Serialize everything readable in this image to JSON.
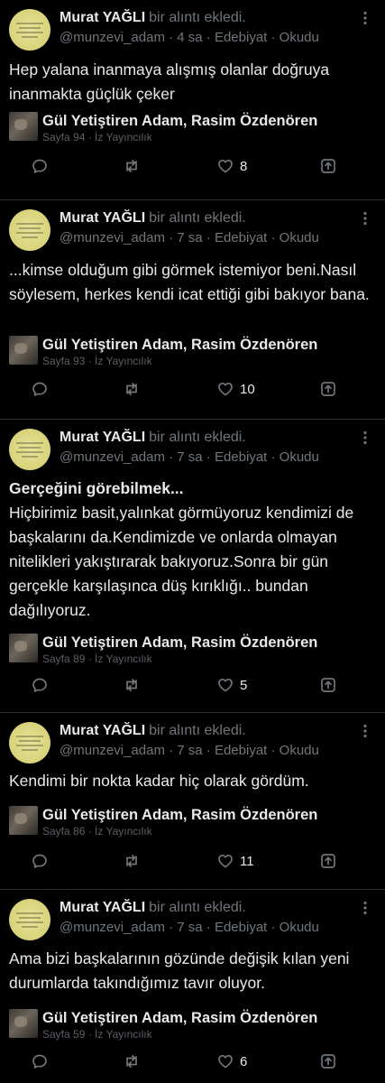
{
  "posts": [
    {
      "author": "Murat YAĞLI",
      "action": "bir alıntı ekledi.",
      "meta": "@munzevi_adam · 4 sa · Edebiyat · Okudu",
      "title": "",
      "text": "Hep yalana inanmaya alışmış olanlar doğruya inanmakta güçlük çeker",
      "book_title": "Gül Yetiştiren Adam, Rasim Özdenören",
      "book_sub": "Sayfa 94 · İz Yayıncılık",
      "likes": "8"
    },
    {
      "author": "Murat YAĞLI",
      "action": "bir alıntı ekledi.",
      "meta": "@munzevi_adam · 7 sa · Edebiyat · Okudu",
      "title": "",
      "text": "...kimse olduğum gibi görmek istemiyor beni.Nasıl söylesem, herkes kendi icat ettiği gibi bakıyor bana.",
      "book_title": "Gül Yetiştiren Adam, Rasim Özdenören",
      "book_sub": "Sayfa 93 · İz Yayıncılık",
      "likes": "10"
    },
    {
      "author": "Murat YAĞLI",
      "action": "bir alıntı ekledi.",
      "meta": "@munzevi_adam · 7 sa · Edebiyat · Okudu",
      "title": "Gerçeğini görebilmek...",
      "text": "Hiçbirimiz basit,yalınkat görmüyoruz kendimizi de başkalarını da.Kendimizde ve onlarda olmayan nitelikleri yakıştırarak bakıyoruz.Sonra bir gün gerçekle karşılaşınca düş kırıklığı.. bundan dağılıyoruz.",
      "book_title": "Gül Yetiştiren Adam, Rasim Özdenören",
      "book_sub": "Sayfa 89 · İz Yayıncılık",
      "likes": "5"
    },
    {
      "author": "Murat YAĞLI",
      "action": "bir alıntı ekledi.",
      "meta": "@munzevi_adam · 7 sa · Edebiyat · Okudu",
      "title": "",
      "text": "Kendimi bir nokta kadar hiç olarak gördüm.",
      "book_title": "Gül Yetiştiren Adam, Rasim Özdenören",
      "book_sub": "Sayfa 86 · İz Yayıncılık",
      "likes": "11"
    },
    {
      "author": "Murat YAĞLI",
      "action": "bir alıntı ekledi.",
      "meta": "@munzevi_adam · 7 sa · Edebiyat · Okudu",
      "title": "",
      "text": "Ama bizi başkalarının gözünde değişik kılan yeni durumlarda takındığımız tavır oluyor.",
      "book_title": "Gül Yetiştiren Adam, Rasim Özdenören",
      "book_sub": "Sayfa 59 · İz Yayıncılık",
      "likes": "6"
    }
  ],
  "colors": {
    "background": "#000000",
    "text": "#e7e9ea",
    "muted": "#71767b",
    "divider": "#2f3336"
  },
  "icons": [
    "more-icon",
    "reply-icon",
    "repost-icon",
    "like-icon",
    "share-icon"
  ]
}
